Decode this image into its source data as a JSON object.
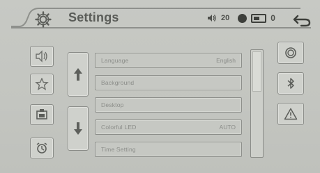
{
  "header": {
    "title": "Settings",
    "volume_level": "20",
    "status_count": "0",
    "icons": [
      "settings-gear-icon",
      "volume-icon",
      "status-dot-icon",
      "battery-icon",
      "back-arrow-icon"
    ]
  },
  "left_sidebar": {
    "items": [
      {
        "icon": "speaker-icon"
      },
      {
        "icon": "star-icon"
      },
      {
        "icon": "display-icon"
      },
      {
        "icon": "clock-icon"
      }
    ]
  },
  "nav_arrows": {
    "up_icon": "arrow-up-icon",
    "down_icon": "arrow-down-icon"
  },
  "menu": {
    "items": [
      {
        "label": "Language",
        "value": "English"
      },
      {
        "label": "Background",
        "value": ""
      },
      {
        "label": "Desktop",
        "value": ""
      },
      {
        "label": "Colorful LED",
        "value": "AUTO"
      },
      {
        "label": "Time Setting",
        "value": ""
      }
    ]
  },
  "right_sidebar": {
    "items": [
      {
        "icon": "target-icon"
      },
      {
        "icon": "bluetooth-icon"
      },
      {
        "icon": "warning-icon"
      }
    ]
  },
  "colors": {
    "background": "#c3c5c0",
    "text_dark": "#5a5c58",
    "text_light": "#8b8d89",
    "border": "#8a8c88"
  }
}
